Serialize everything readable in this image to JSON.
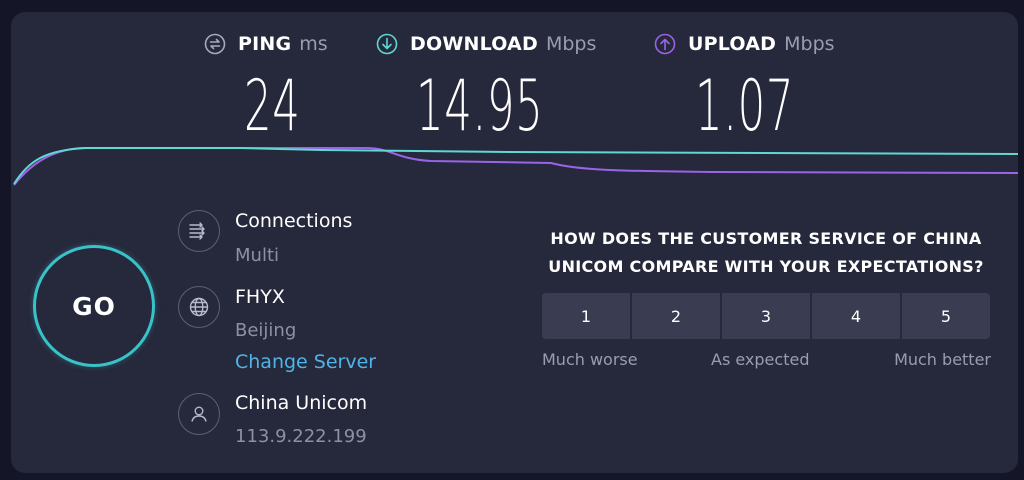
{
  "metrics": {
    "ping": {
      "name": "PING",
      "unit": "ms",
      "value": "24",
      "icon": "ping-icon"
    },
    "download": {
      "name": "DOWNLOAD",
      "unit": "Mbps",
      "value": "14.95",
      "icon": "download-icon"
    },
    "upload": {
      "name": "UPLOAD",
      "unit": "Mbps",
      "value": "1.07",
      "icon": "upload-icon"
    }
  },
  "colors": {
    "download": "#5fd8d2",
    "upload": "#9b63e8",
    "go": "#39c3c9",
    "link": "#4fb4e8"
  },
  "go_button": {
    "label": "GO"
  },
  "connections": {
    "title": "Connections",
    "value": "Multi"
  },
  "server": {
    "name": "FHYX",
    "location": "Beijing",
    "change_label": "Change Server"
  },
  "isp": {
    "name": "China Unicom",
    "ip": "113.9.222.199"
  },
  "survey": {
    "question": "HOW DOES THE CUSTOMER SERVICE OF CHINA UNICOM COMPARE WITH YOUR EXPECTATIONS?",
    "options": [
      "1",
      "2",
      "3",
      "4",
      "5"
    ],
    "label_low": "Much worse",
    "label_mid": "As expected",
    "label_high": "Much better"
  }
}
